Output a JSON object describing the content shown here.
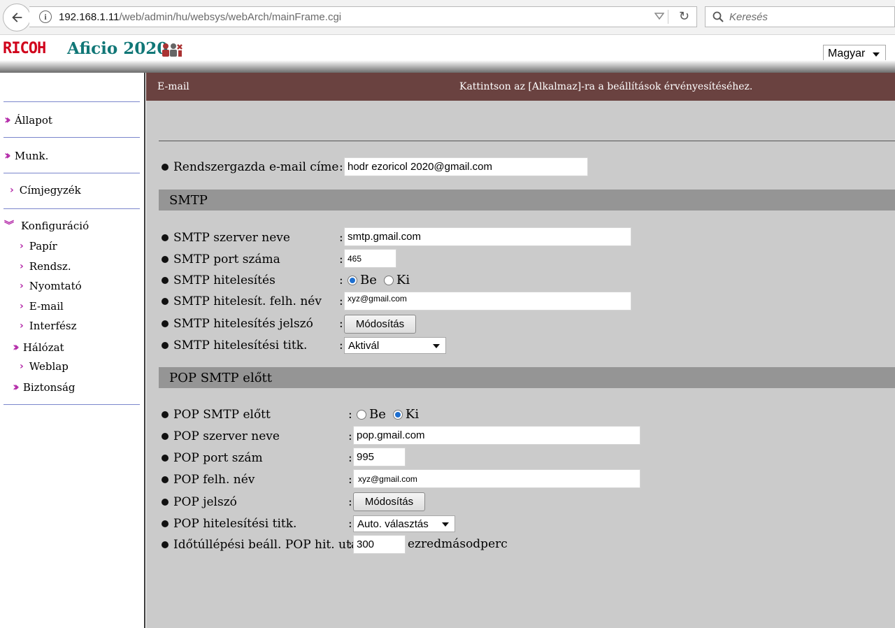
{
  "browser": {
    "url_host": "192.168.1.11",
    "url_path": "/web/admin/hu/websys/webArch/mainFrame.cgi",
    "search_placeholder": "Keresés"
  },
  "header": {
    "brand": "RICOH",
    "model": "Aficio 2020",
    "language": "Magyar"
  },
  "sidebar": {
    "items": [
      {
        "label": "Állapot"
      },
      {
        "label": "Munk."
      },
      {
        "label": "Címjegyzék"
      },
      {
        "label": "Konfiguráció"
      },
      {
        "label": "Papír"
      },
      {
        "label": "Rendsz."
      },
      {
        "label": "Nyomtató"
      },
      {
        "label": "E-mail"
      },
      {
        "label": "Interfész"
      },
      {
        "label": "Hálózat"
      },
      {
        "label": "Weblap"
      },
      {
        "label": "Biztonság"
      }
    ]
  },
  "page": {
    "title": "E-mail",
    "hint": "Kattintson az [Alkalmaz]-ra a beállítások érvényesítéséhez."
  },
  "admin": {
    "label": "Rendszergazda e-mail címe",
    "value": "hodr  ezoricol 2020@gmail.com"
  },
  "smtp": {
    "section": "SMTP",
    "server_label": "SMTP szerver neve",
    "server_value": "smtp.gmail.com",
    "port_label": "SMTP port száma",
    "port_value": "465",
    "auth_label": "SMTP hitelesítés",
    "auth_on": "Be",
    "auth_off": "Ki",
    "user_label": "SMTP hitelesít. felh. név",
    "user_value": "xyz@gmail.com",
    "pass_label": "SMTP hitelesítés jelszó",
    "pass_button": "Módosítás",
    "enc_label": "SMTP hitelesítési titk.",
    "enc_value": "Aktivál"
  },
  "pop": {
    "section": "POP SMTP előtt",
    "before_label": "POP SMTP előtt",
    "before_on": "Be",
    "before_off": "Ki",
    "server_label": "POP szerver neve",
    "server_value": "pop.gmail.com",
    "port_label": "POP port szám",
    "port_value": "995",
    "user_label": "POP felh. név",
    "user_value": "xyz@gmail.com",
    "pass_label": "POP jelszó",
    "pass_button": "Módosítás",
    "enc_label": "POP hitelesítési titk.",
    "enc_value": "Auto. választás",
    "timeout_label": "Időtúllépési beáll. POP hit. után",
    "timeout_value": "300",
    "timeout_unit": "ezredmásodperc"
  },
  "colors": {
    "titlebar": "#6a4240",
    "panel": "#cbcbcb",
    "section": "#959595",
    "accent_arrow": "#b329a8",
    "brand_red": "#d0021b",
    "model_teal": "#117777"
  }
}
